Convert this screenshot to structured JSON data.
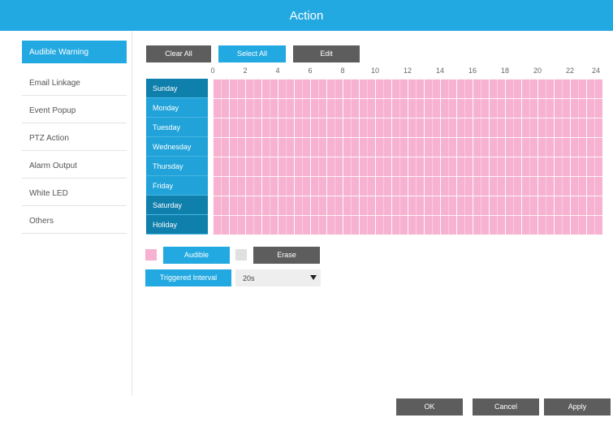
{
  "window": {
    "title": "Action"
  },
  "sidebar": {
    "items": [
      {
        "label": "Audible Warning",
        "active": true
      },
      {
        "label": "Email Linkage"
      },
      {
        "label": "Event Popup"
      },
      {
        "label": "PTZ Action"
      },
      {
        "label": "Alarm Output"
      },
      {
        "label": "White LED"
      },
      {
        "label": "Others"
      }
    ]
  },
  "toolbar": {
    "clear_all": "Clear All",
    "select_all": "Select All",
    "edit": "Edit"
  },
  "schedule": {
    "hour_labels": [
      "0",
      "2",
      "4",
      "6",
      "8",
      "10",
      "12",
      "14",
      "16",
      "18",
      "20",
      "22",
      "24"
    ],
    "days": [
      "Sunday",
      "Monday",
      "Tuesday",
      "Wednesday",
      "Thursday",
      "Friday",
      "Saturday",
      "Holiday"
    ],
    "fill_color": "#f7b2d1"
  },
  "legend": {
    "audible_label": "Audible",
    "audible_color": "#f7b2d1",
    "erase_label": "Erase",
    "erase_color": "#e0e0e0"
  },
  "trigger": {
    "label": "Triggered Interval",
    "value": "20s"
  },
  "footer": {
    "ok": "OK",
    "cancel": "Cancel",
    "apply": "Apply"
  },
  "colors": {
    "accent": "#23a9e1",
    "dark_button": "#5d5d5d",
    "day_dark": "#0f7fab"
  }
}
